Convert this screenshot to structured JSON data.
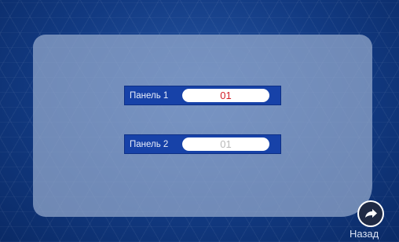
{
  "panels": [
    {
      "label": "Панель 1",
      "value": "01",
      "value_color": "#d3202a"
    },
    {
      "label": "Панель 2",
      "value": "01",
      "value_color": "#b9b9b9"
    }
  ],
  "back": {
    "label": "Назад",
    "icon": "arrow-forward-icon"
  },
  "colors": {
    "row_bg": "#1742a8",
    "frame": "#96aacd",
    "background": "#123a82"
  }
}
